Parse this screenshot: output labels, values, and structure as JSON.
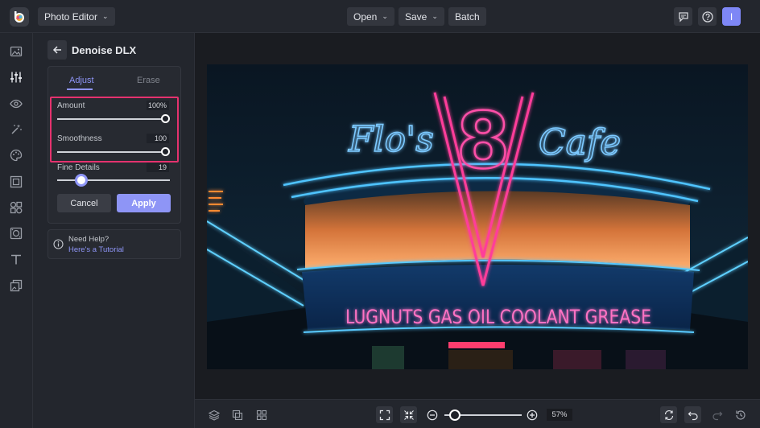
{
  "topbar": {
    "app_menu_label": "Photo Editor",
    "open_label": "Open",
    "save_label": "Save",
    "batch_label": "Batch",
    "avatar_initial": "I"
  },
  "leftbar": {
    "icons": [
      "image-icon",
      "adjust-sliders-icon",
      "eye-icon",
      "magic-wand-icon",
      "palette-icon",
      "frame-icon",
      "shapes-icon",
      "texture-icon",
      "text-icon",
      "collage-icon"
    ]
  },
  "panel": {
    "title": "Denoise DLX",
    "tabs": [
      {
        "label": "Adjust",
        "active": true
      },
      {
        "label": "Erase",
        "active": false
      }
    ],
    "sliders": [
      {
        "label": "Amount",
        "value_text": "100%",
        "fraction": 1.0
      },
      {
        "label": "Smoothness",
        "value_text": "100",
        "fraction": 1.0
      },
      {
        "label": "Fine Details",
        "value_text": "19",
        "fraction": 0.19
      }
    ],
    "cancel_label": "Cancel",
    "apply_label": "Apply",
    "help": {
      "title": "Need Help?",
      "link": "Here's a Tutorial"
    }
  },
  "canvas": {
    "neon_sign": {
      "script_left": "Flo's",
      "number": "8",
      "script_right": "Cafe",
      "banner": "LUGNUTS GAS OIL COOLANT GREASE"
    }
  },
  "bottombar": {
    "zoom_percent": "57%",
    "zoom_fraction": 0.57
  },
  "colors": {
    "accent": "#8e95f6",
    "highlight_border": "#e5326e",
    "neon_pink": "#ff3d9a",
    "neon_blue": "#39a8ff"
  }
}
